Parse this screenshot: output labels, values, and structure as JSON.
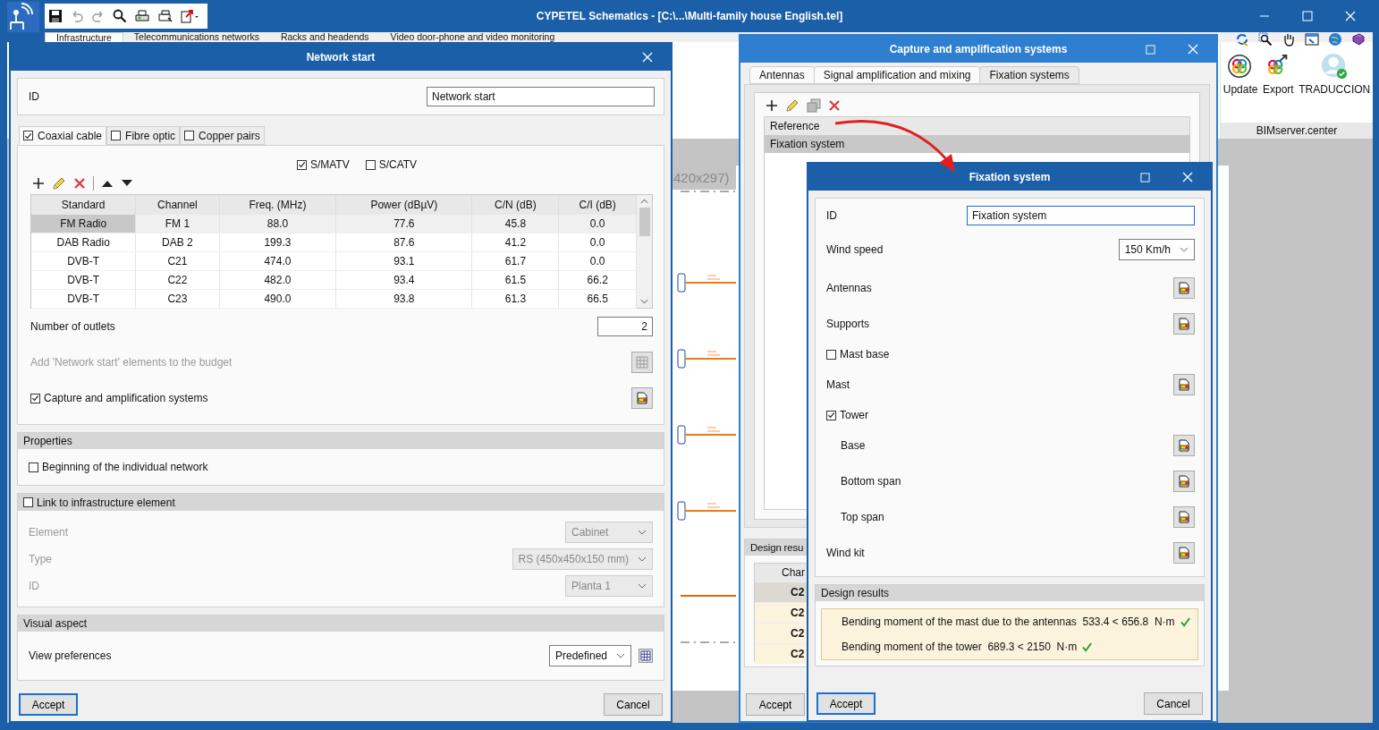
{
  "app": {
    "title": "CYPETEL Schematics - [C:\\...\\Multi-family house English.tel]",
    "ribbon_tabs": [
      {
        "label": "Infrastructure",
        "selected": true
      },
      {
        "label": "Telecommunications networks",
        "selected": false
      },
      {
        "label": "Racks and headends",
        "selected": false
      },
      {
        "label": "Video door-phone and video monitoring",
        "selected": false
      }
    ],
    "bim_tools": [
      "Update",
      "Export",
      "TRADUCCION"
    ],
    "bim_group": "BIMserver.center",
    "sheet_label": "420x297)"
  },
  "network_start": {
    "title": "Network start",
    "id_label": "ID",
    "id_value": "Network start",
    "tabs": [
      {
        "label": "Coaxial cable",
        "checked": true,
        "selected": true
      },
      {
        "label": "Fibre optic",
        "checked": false,
        "selected": false
      },
      {
        "label": "Copper pairs",
        "checked": false,
        "selected": false
      }
    ],
    "systems": [
      {
        "label": "S/MATV",
        "checked": true
      },
      {
        "label": "S/CATV",
        "checked": false
      }
    ],
    "columns": [
      "Standard",
      "Channel",
      "Freq. (MHz)",
      "Power (dBµV)",
      "C/N (dB)",
      "C/I (dB)"
    ],
    "rows": [
      {
        "selected": true,
        "cells": [
          "FM Radio",
          "FM 1",
          "88.0",
          "77.6",
          "45.8",
          "0.0"
        ]
      },
      {
        "selected": false,
        "cells": [
          "DAB Radio",
          "DAB 2",
          "199.3",
          "87.6",
          "41.2",
          "0.0"
        ]
      },
      {
        "selected": false,
        "cells": [
          "DVB-T",
          "C21",
          "474.0",
          "93.1",
          "61.7",
          "0.0"
        ]
      },
      {
        "selected": false,
        "cells": [
          "DVB-T",
          "C22",
          "482.0",
          "93.4",
          "61.5",
          "66.2"
        ]
      },
      {
        "selected": false,
        "cells": [
          "DVB-T",
          "C23",
          "490.0",
          "93.8",
          "61.3",
          "66.5"
        ]
      }
    ],
    "outlets_label": "Number of outlets",
    "outlets_value": "2",
    "budget": {
      "label": "Add 'Network start' elements to the budget",
      "disabled": true
    },
    "capture": {
      "label": "Capture and amplification systems",
      "checked": true
    },
    "properties": {
      "title": "Properties",
      "option": {
        "label": "Beginning of the individual network",
        "checked": false
      }
    },
    "link": {
      "label": "Link to infrastructure element",
      "checked": false,
      "fields": [
        {
          "label": "Element",
          "value": "Cabinet"
        },
        {
          "label": "Type",
          "value": "RS (450x450x150 mm)"
        },
        {
          "label": "ID",
          "value": "Planta 1"
        }
      ]
    },
    "visual": {
      "title": "Visual aspect",
      "label": "View preferences",
      "value": "Predefined"
    },
    "buttons": [
      "Accept",
      "Cancel"
    ]
  },
  "capture_systems": {
    "title": "Capture and amplification systems",
    "tabs": [
      {
        "label": "Antennas",
        "selected": false
      },
      {
        "label": "Signal amplification and mixing",
        "selected": false
      },
      {
        "label": "Fixation systems",
        "selected": true
      }
    ],
    "list_heading": "Reference",
    "list": [
      {
        "label": "Fixation system",
        "selected": true
      }
    ],
    "results_title": "Design resu",
    "results_column": "Char",
    "results_rows": [
      {
        "label": "C2",
        "selected": true
      },
      {
        "label": "C2",
        "selected": false
      },
      {
        "label": "C2",
        "selected": false
      },
      {
        "label": "C2",
        "selected": false
      }
    ],
    "buttons": [
      "Accept"
    ]
  },
  "fixation_system": {
    "title": "Fixation system",
    "id_label": "ID",
    "id_value": "Fixation system",
    "wind_label": "Wind speed",
    "wind_value": "150 Km/h",
    "items": [
      {
        "kind": "edit",
        "label": "Antennas"
      },
      {
        "kind": "edit",
        "label": "Supports"
      },
      {
        "kind": "check",
        "label": "Mast base",
        "checked": false
      },
      {
        "kind": "edit",
        "label": "Mast"
      },
      {
        "kind": "check",
        "label": "Tower",
        "checked": true,
        "children": [
          {
            "kind": "edit",
            "label": "Base"
          },
          {
            "kind": "edit",
            "label": "Bottom span"
          },
          {
            "kind": "edit",
            "label": "Top span"
          }
        ]
      },
      {
        "kind": "edit",
        "label": "Wind kit"
      }
    ],
    "results_title": "Design results",
    "results": [
      {
        "text": "Bending moment of the mast due to the antennas",
        "value": "533.4 < 656.8",
        "unit": "N·m",
        "ok": true
      },
      {
        "text": "Bending moment of the tower",
        "value": "689.3 < 2150",
        "unit": "N·m",
        "ok": true
      }
    ],
    "buttons": [
      "Accept",
      "Cancel"
    ]
  }
}
